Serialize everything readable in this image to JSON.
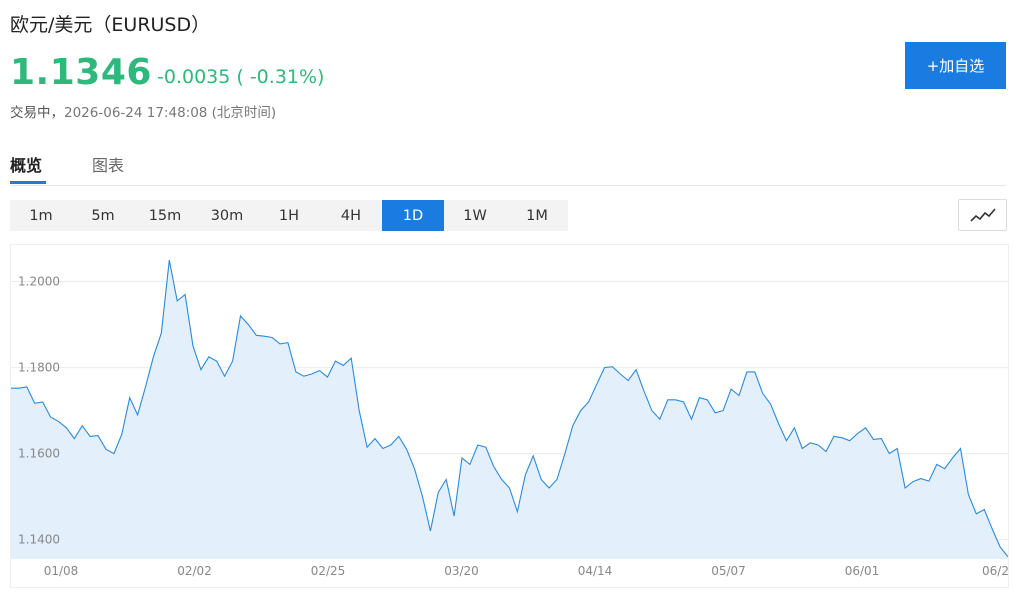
{
  "header": {
    "title": "欧元/美元（EURUSD）",
    "price": "1.1346",
    "change": "-0.0035 ( -0.31%)",
    "status": "交易中，",
    "timestamp": "2026-06-24 17:48:08 (北京时间)",
    "watch_label": "+加自选"
  },
  "tabs": [
    {
      "label": "概览",
      "active": true
    },
    {
      "label": "图表",
      "active": false
    }
  ],
  "periods": [
    {
      "label": "1m",
      "active": false
    },
    {
      "label": "5m",
      "active": false
    },
    {
      "label": "15m",
      "active": false
    },
    {
      "label": "30m",
      "active": false
    },
    {
      "label": "1H",
      "active": false
    },
    {
      "label": "4H",
      "active": false
    },
    {
      "label": "1D",
      "active": true
    },
    {
      "label": "1W",
      "active": false
    },
    {
      "label": "1M",
      "active": false
    }
  ],
  "chart_type_icon": "line-chart-icon",
  "colors": {
    "up": "#2eb87b",
    "accent": "#1a7be0",
    "line": "#2b8ad8",
    "area": "#e3effb"
  },
  "chart_data": {
    "type": "area",
    "ylim": [
      1.1355,
      1.2085
    ],
    "y_ticks": [
      "1.2000",
      "1.1800",
      "1.1600",
      "1.1400"
    ],
    "x_ticks": [
      "01/08",
      "02/02",
      "02/25",
      "03/20",
      "04/14",
      "05/07",
      "06/01",
      "06/2"
    ],
    "grid": true,
    "values": [
      1.1752,
      1.1752,
      1.1755,
      1.1717,
      1.172,
      1.1685,
      1.1675,
      1.166,
      1.1635,
      1.1665,
      1.164,
      1.1642,
      1.161,
      1.16,
      1.1645,
      1.173,
      1.169,
      1.1755,
      1.1825,
      1.188,
      1.205,
      1.1955,
      1.197,
      1.185,
      1.1795,
      1.1825,
      1.1815,
      1.178,
      1.1815,
      1.192,
      1.19,
      1.1875,
      1.1873,
      1.187,
      1.1855,
      1.1858,
      1.179,
      1.178,
      1.1785,
      1.1793,
      1.1778,
      1.1815,
      1.1805,
      1.1822,
      1.17,
      1.1615,
      1.1635,
      1.1612,
      1.162,
      1.164,
      1.161,
      1.1565,
      1.15,
      1.142,
      1.151,
      1.154,
      1.1455,
      1.159,
      1.1575,
      1.162,
      1.1615,
      1.157,
      1.154,
      1.152,
      1.1465,
      1.155,
      1.1595,
      1.154,
      1.152,
      1.154,
      1.16,
      1.1665,
      1.17,
      1.172,
      1.176,
      1.18,
      1.1802,
      1.1785,
      1.177,
      1.1795,
      1.1745,
      1.17,
      1.168,
      1.1725,
      1.1725,
      1.172,
      1.168,
      1.173,
      1.1725,
      1.1695,
      1.17,
      1.175,
      1.1735,
      1.179,
      1.179,
      1.174,
      1.1715,
      1.167,
      1.163,
      1.166,
      1.1612,
      1.1625,
      1.162,
      1.1605,
      1.164,
      1.1637,
      1.163,
      1.1647,
      1.166,
      1.1633,
      1.1635,
      1.16,
      1.1612,
      1.152,
      1.1535,
      1.1542,
      1.1536,
      1.1575,
      1.1565,
      1.159,
      1.1612,
      1.1505,
      1.146,
      1.147,
      1.1425,
      1.1383,
      1.136
    ]
  }
}
